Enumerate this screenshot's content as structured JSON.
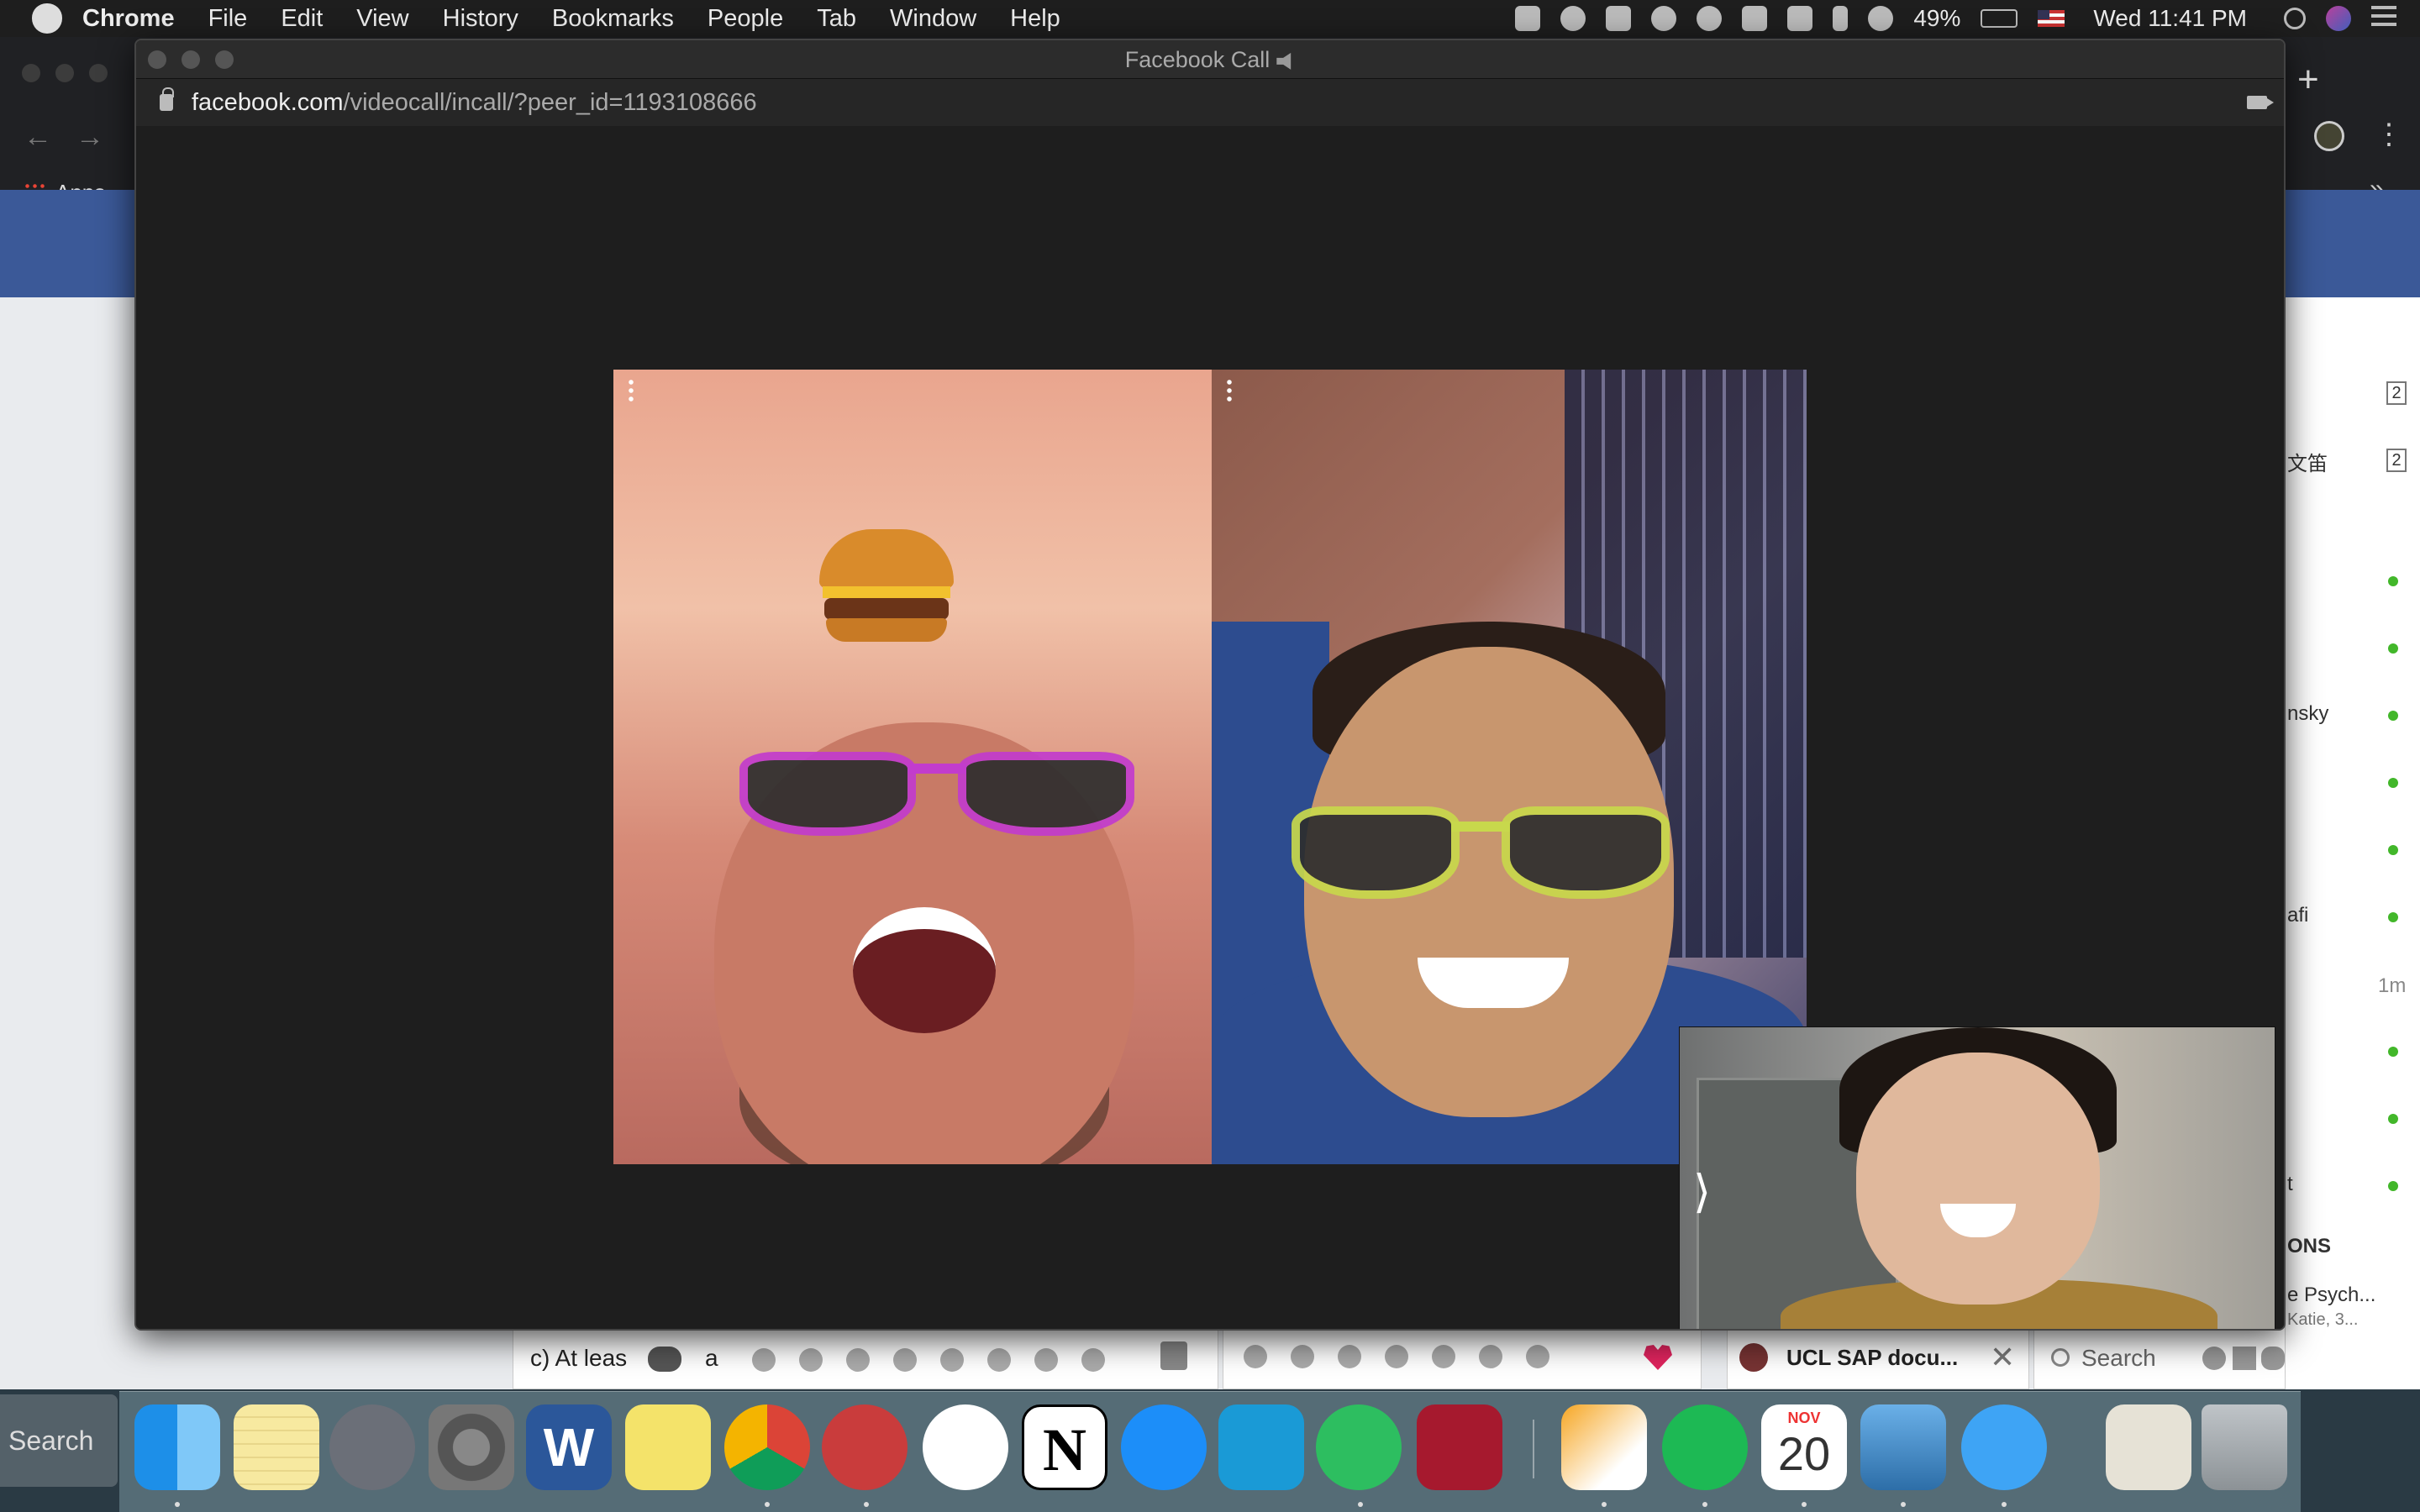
{
  "menubar": {
    "app_name": "Chrome",
    "items": [
      "File",
      "Edit",
      "View",
      "History",
      "Bookmarks",
      "People",
      "Tab",
      "Window",
      "Help"
    ],
    "battery": "49%",
    "datetime": "Wed 11:41 PM",
    "tray_icons": [
      "evernote-icon",
      "creative-cloud-icon",
      "dropbox-icon",
      "cloud-icon",
      "sync-icon",
      "grid-icon",
      "malwarebytes-icon",
      "bluetooth-icon",
      "wifi-icon",
      "battery-icon",
      "flag-us-icon",
      "search-icon",
      "siri-icon",
      "notification-center-icon"
    ]
  },
  "background_browser": {
    "bookmarks_apps_label": "Apps",
    "sidebar": {
      "badges": [
        "2",
        "2"
      ],
      "snippets": [
        "文笛",
        "nsky",
        "afi",
        "1m",
        "t",
        "ONS",
        "e Psych...",
        "Katie, 3..."
      ]
    },
    "chatbars": {
      "chat1_text": "c) At leas",
      "chat1_extra": "a",
      "chat3_title": "UCL SAP docu...",
      "search_placeholder": "Search"
    }
  },
  "call_window": {
    "title": "Facebook Call",
    "url_host": "facebook.com",
    "url_path": "/videocall/incall/?peer_id=1193108666"
  },
  "dock": {
    "search_label": "Search",
    "apps": [
      "finder-icon",
      "notes-icon",
      "launchpad-icon",
      "system-preferences-icon",
      "word-icon",
      "stickies-icon",
      "chrome-icon",
      "bear-icon",
      "slack-icon",
      "notion-icon",
      "app-store-icon",
      "kindle-icon",
      "evernote-icon",
      "mendeley-icon",
      "pages-icon",
      "spotify-icon",
      "calendar-icon",
      "preview-icon",
      "messages-icon",
      "documents-folder-icon",
      "trash-icon"
    ],
    "calendar": {
      "month": "NOV",
      "day": "20"
    }
  },
  "colors": {
    "menubar_bg": "#1e1e1e",
    "facebook_blue": "#3b5998",
    "call_window_bg": "#1e1e1e",
    "online_green": "#42b72a"
  }
}
